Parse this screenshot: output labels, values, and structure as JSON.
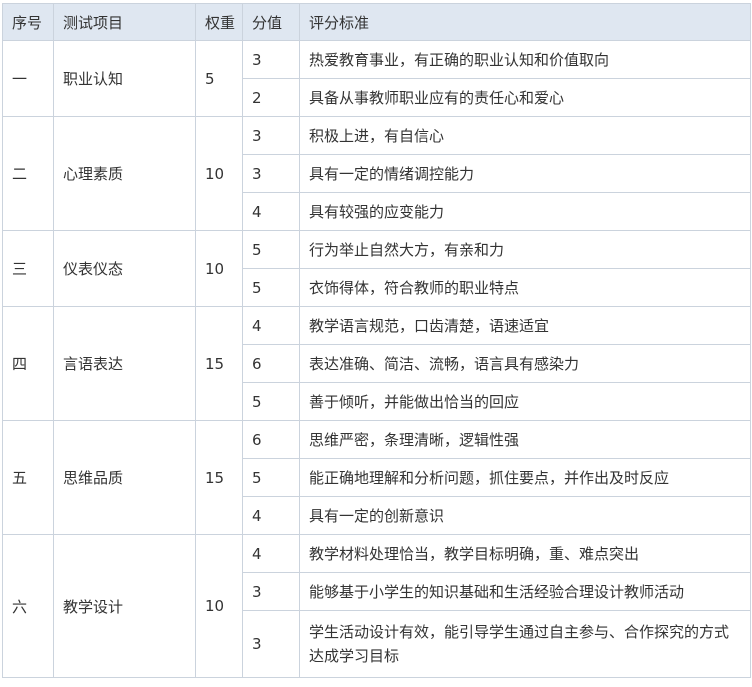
{
  "header": {
    "no": "序号",
    "item": "测试项目",
    "weight": "权重",
    "score": "分值",
    "criteria": "评分标准"
  },
  "groups": [
    {
      "no": "一",
      "item": "职业认知",
      "weight": "5",
      "rows": [
        {
          "score": "3",
          "criteria": "热爱教育事业，有正确的职业认知和价值取向"
        },
        {
          "score": "2",
          "criteria": "具备从事教师职业应有的责任心和爱心"
        }
      ]
    },
    {
      "no": "二",
      "item": "心理素质",
      "weight": "10",
      "rows": [
        {
          "score": "3",
          "criteria": "积极上进，有自信心"
        },
        {
          "score": "3",
          "criteria": "具有一定的情绪调控能力"
        },
        {
          "score": "4",
          "criteria": "具有较强的应变能力"
        }
      ]
    },
    {
      "no": "三",
      "item": "仪表仪态",
      "weight": "10",
      "rows": [
        {
          "score": "5",
          "criteria": "行为举止自然大方，有亲和力"
        },
        {
          "score": "5",
          "criteria": "衣饰得体，符合教师的职业特点"
        }
      ]
    },
    {
      "no": "四",
      "item": "言语表达",
      "weight": "15",
      "rows": [
        {
          "score": "4",
          "criteria": "教学语言规范，口齿清楚，语速适宜"
        },
        {
          "score": "6",
          "criteria": "表达准确、简洁、流畅，语言具有感染力"
        },
        {
          "score": "5",
          "criteria": "善于倾听，并能做出恰当的回应"
        }
      ]
    },
    {
      "no": "五",
      "item": "思维品质",
      "weight": "15",
      "rows": [
        {
          "score": "6",
          "criteria": "思维严密，条理清晰，逻辑性强"
        },
        {
          "score": "5",
          "criteria": "能正确地理解和分析问题，抓住要点，并作出及时反应"
        },
        {
          "score": "4",
          "criteria": "具有一定的创新意识"
        }
      ]
    },
    {
      "no": "六",
      "item": "教学设计",
      "weight": "10",
      "rows": [
        {
          "score": "4",
          "criteria": "教学材料处理恰当，教学目标明确，重、难点突出"
        },
        {
          "score": "3",
          "criteria": "能够基于小学生的知识基础和生活经验合理设计教师活动"
        },
        {
          "score": "3",
          "criteria": "学生活动设计有效，能引导学生通过自主参与、合作探究的方式达成学习目标",
          "wrap": true
        }
      ]
    }
  ]
}
